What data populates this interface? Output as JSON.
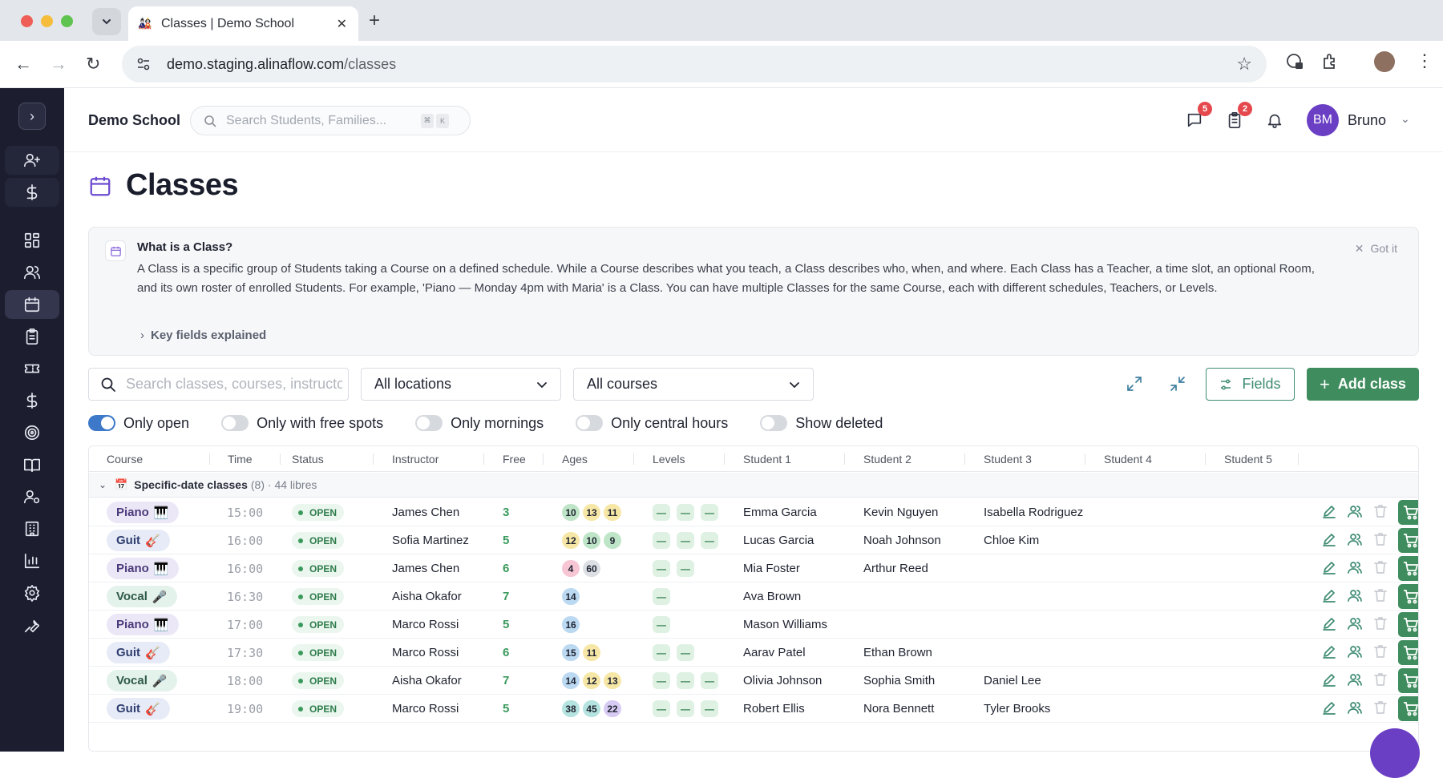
{
  "browser": {
    "tab_title": "Classes | Demo School",
    "url_host": "demo.staging.alinaflow.com",
    "url_path": "/classes"
  },
  "header": {
    "school_name": "Demo School",
    "search_placeholder": "Search Students, Families...",
    "kbd_cmd": "⌘",
    "kbd_k": "K",
    "messages_badge": "5",
    "tasks_badge": "2",
    "avatar_initials": "BM",
    "user_name": "Bruno"
  },
  "page": {
    "title": "Classes"
  },
  "info": {
    "title": "What is a Class?",
    "text": "A Class is a specific group of Students taking a Course on a defined schedule. While a Course describes what you teach, a Class describes who, when, and where. Each Class has a Teacher, a time slot, an optional Room, and its own roster of enrolled Students. For example, 'Piano — Monday 4pm with Maria' is a Class. You can have multiple Classes for the same Course, each with different schedules, Teachers, or Levels.",
    "got_it": "Got it",
    "key_fields": "Key fields explained"
  },
  "filters": {
    "search_placeholder": "Search classes, courses, instructors",
    "location": "All locations",
    "course": "All courses",
    "fields_label": "Fields",
    "add_label": "Add class"
  },
  "toggles": [
    {
      "label": "Only open",
      "on": true
    },
    {
      "label": "Only with free spots",
      "on": false
    },
    {
      "label": "Only mornings",
      "on": false
    },
    {
      "label": "Only central hours",
      "on": false
    },
    {
      "label": "Show deleted",
      "on": false
    }
  ],
  "table": {
    "columns": [
      "Course",
      "Time",
      "Status",
      "Instructor",
      "Free",
      "Ages",
      "Levels",
      "Student 1",
      "Student 2",
      "Student 3",
      "Student 4",
      "Student 5"
    ],
    "group": {
      "emoji": "📅",
      "name": "Specific-date classes",
      "count": "(8) · 44 libres"
    },
    "rows": [
      {
        "course": "Piano",
        "emoji": "🎹",
        "kind": "piano",
        "time": "15:00",
        "status": "OPEN",
        "instructor": "James Chen",
        "free": "3",
        "ages": [
          "10",
          "13",
          "11"
        ],
        "levels": 3,
        "students": [
          "Emma Garcia",
          "Kevin Nguyen",
          "Isabella Rodriguez",
          "",
          ""
        ]
      },
      {
        "course": "Guit",
        "emoji": "🎸",
        "kind": "guit",
        "time": "16:00",
        "status": "OPEN",
        "instructor": "Sofia Martinez",
        "free": "5",
        "ages": [
          "12",
          "10",
          "9"
        ],
        "levels": 3,
        "students": [
          "Lucas Garcia",
          "Noah Johnson",
          "Chloe Kim",
          "",
          ""
        ]
      },
      {
        "course": "Piano",
        "emoji": "🎹",
        "kind": "piano",
        "time": "16:00",
        "status": "OPEN",
        "instructor": "James Chen",
        "free": "6",
        "ages": [
          "4",
          "60"
        ],
        "levels": 2,
        "students": [
          "Mia Foster",
          "Arthur Reed",
          "",
          "",
          ""
        ]
      },
      {
        "course": "Vocal",
        "emoji": "🎤",
        "kind": "vocal",
        "time": "16:30",
        "status": "OPEN",
        "instructor": "Aisha Okafor",
        "free": "7",
        "ages": [
          "14"
        ],
        "levels": 1,
        "students": [
          "Ava Brown",
          "",
          "",
          "",
          ""
        ]
      },
      {
        "course": "Piano",
        "emoji": "🎹",
        "kind": "piano",
        "time": "17:00",
        "status": "OPEN",
        "instructor": "Marco Rossi",
        "free": "5",
        "ages": [
          "16"
        ],
        "levels": 1,
        "students": [
          "Mason Williams",
          "",
          "",
          "",
          ""
        ]
      },
      {
        "course": "Guit",
        "emoji": "🎸",
        "kind": "guit",
        "time": "17:30",
        "status": "OPEN",
        "instructor": "Marco Rossi",
        "free": "6",
        "ages": [
          "15",
          "11"
        ],
        "levels": 2,
        "students": [
          "Aarav Patel",
          "Ethan Brown",
          "",
          "",
          ""
        ]
      },
      {
        "course": "Vocal",
        "emoji": "🎤",
        "kind": "vocal",
        "time": "18:00",
        "status": "OPEN",
        "instructor": "Aisha Okafor",
        "free": "7",
        "ages": [
          "14",
          "12",
          "13"
        ],
        "levels": 3,
        "students": [
          "Olivia Johnson",
          "Sophia Smith",
          "Daniel Lee",
          "",
          ""
        ]
      },
      {
        "course": "Guit",
        "emoji": "🎸",
        "kind": "guit",
        "time": "19:00",
        "status": "OPEN",
        "instructor": "Marco Rossi",
        "free": "5",
        "ages": [
          "38",
          "45",
          "22"
        ],
        "levels": 3,
        "students": [
          "Robert Ellis",
          "Nora Bennett",
          "Tyler Brooks",
          "",
          ""
        ]
      }
    ],
    "level_mark": "—"
  },
  "colors": {
    "accent": "#6a3fc4",
    "primary_green": "#3f8d5e",
    "sidebar_bg": "#1c1e2f",
    "age_colors": {
      "4": "#f6c6d4",
      "9": "#bfe5c8",
      "10": "#bfe5c8",
      "11": "#f7e7a6",
      "12": "#f7e7a6",
      "13": "#f7e7a6",
      "14": "#bcd9f2",
      "15": "#bcd9f2",
      "16": "#bcd9f2",
      "22": "#d8cbf3",
      "38": "#b5e3e0",
      "45": "#b5e3e0",
      "60": "#dcdfe4"
    }
  }
}
